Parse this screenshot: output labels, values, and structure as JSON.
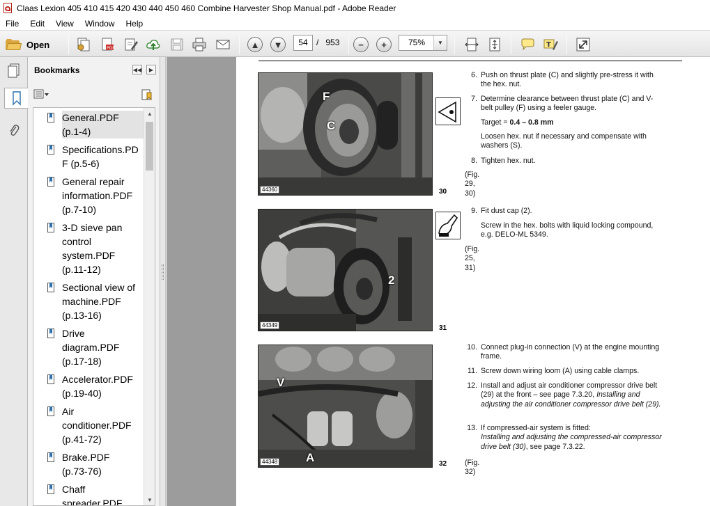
{
  "window": {
    "title": "Claas Lexion 405 410 415 420 430 440 450 460 Combine Harvester Shop Manual.pdf - Adobe Reader"
  },
  "menu": [
    "File",
    "Edit",
    "View",
    "Window",
    "Help"
  ],
  "toolbar": {
    "open_label": "Open",
    "current_page": "54",
    "page_separator": "/",
    "total_pages": "953",
    "zoom": "75%"
  },
  "bookmarks": {
    "title": "Bookmarks",
    "items": [
      {
        "label": "General.PDF (p.1-4)",
        "lines": [
          "General.PDF",
          "(p.1-4)"
        ]
      },
      {
        "label": "Specifications.PDF (p.5-6)",
        "lines": [
          "Specifications.PD",
          "F (p.5-6)"
        ]
      },
      {
        "label": "General repair information.PDF (p.7-10)",
        "lines": [
          "General repair",
          "information.PDF",
          "(p.7-10)"
        ]
      },
      {
        "label": "3-D sieve pan control system.PDF (p.11-12)",
        "lines": [
          "3-D sieve pan",
          "control",
          "system.PDF",
          "(p.11-12)"
        ]
      },
      {
        "label": "Sectional view of machine.PDF (p.13-16)",
        "lines": [
          "Sectional view of",
          "machine.PDF",
          "(p.13-16)"
        ]
      },
      {
        "label": "Drive diagram.PDF (p.17-18)",
        "lines": [
          "Drive",
          "diagram.PDF",
          "(p.17-18)"
        ]
      },
      {
        "label": "Accelerator.PDF (p.19-40)",
        "lines": [
          "Accelerator.PDF",
          "(p.19-40)"
        ]
      },
      {
        "label": "Air conditioner.PDF (p.41-72)",
        "lines": [
          "Air",
          "conditioner.PDF",
          "(p.41-72)"
        ]
      },
      {
        "label": "Brake.PDF (p.73-76)",
        "lines": [
          "Brake.PDF",
          "(p.73-76)"
        ]
      },
      {
        "label": "Chaff spreader.PDF",
        "lines": [
          "Chaff",
          "spreader.PDF"
        ]
      }
    ]
  },
  "document": {
    "figures": [
      {
        "id": "44360",
        "number": "30",
        "callouts": [
          "F",
          "C"
        ]
      },
      {
        "id": "44349",
        "number": "31",
        "callouts": [
          "2"
        ]
      },
      {
        "id": "44348",
        "number": "32",
        "callouts": [
          "V",
          "A"
        ]
      }
    ],
    "block1": {
      "step6_num": "6.",
      "step6": "Push on thrust plate (C) and slightly pre-stress it with the hex. nut.",
      "step7_num": "7.",
      "step7": "Determine clearance between thrust plate (C) and V-belt pulley (F) using a feeler gauge.",
      "target_prefix": "Target = ",
      "target_value": "0.4 – 0.8 mm",
      "loosen": "Loosen hex. nut if necessary and compensate with washers (S).",
      "step8_num": "8.",
      "step8": "Tighten hex. nut.",
      "ref": "(Fig. 29, 30)"
    },
    "block2": {
      "step9_num": "9.",
      "step9": "Fit dust cap (2).",
      "screw": "Screw in the hex. bolts with liquid locking compound, e.g. DELO-ML 5349.",
      "ref": "(Fig. 25, 31)"
    },
    "block3": {
      "step10_num": "10.",
      "step10": "Connect plug-in connection (V) at the engine mounting frame.",
      "step11_num": "11.",
      "step11": "Screw down wiring loom (A) using cable clamps.",
      "step12_num": "12.",
      "step12_a": "Install and adjust air conditioner compressor drive belt (29) at the front – see page 7.3.20, ",
      "step12_b": "Installing and adjusting the air conditioner compressor drive belt (29)",
      "step12_c": ".",
      "step13_num": "13.",
      "step13_a": "If compressed-air system is fitted:",
      "step13_b": "Installing and adjusting the compressed-air compressor drive belt (30)",
      "step13_c": ", see page 7.3.22.",
      "ref": "(Fig. 32)"
    }
  }
}
